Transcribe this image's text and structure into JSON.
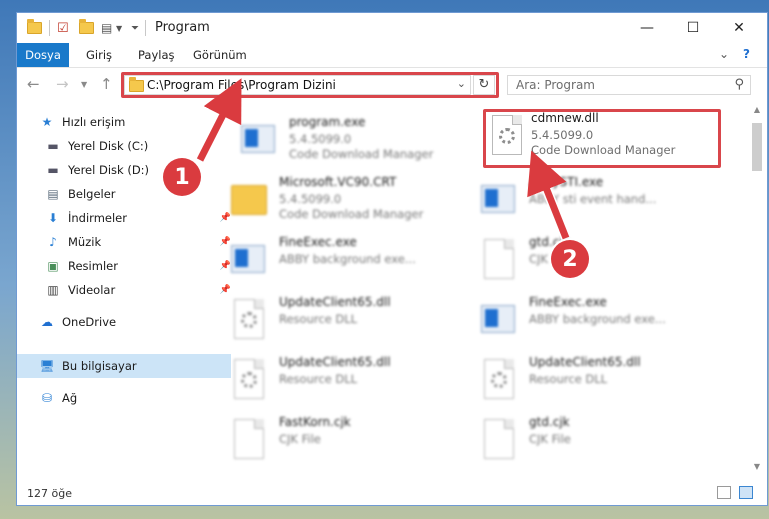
{
  "window": {
    "title": "Program"
  },
  "ribbon": {
    "tabs": [
      {
        "label": "Dosya",
        "active": true
      },
      {
        "label": "Giriş"
      },
      {
        "label": "Paylaş"
      },
      {
        "label": "Görünüm"
      }
    ]
  },
  "navbar": {
    "address": "C:\\Program Files\\Program Dizini",
    "search_placeholder": "Ara: Program"
  },
  "navpane": {
    "items": [
      {
        "label": "Hızlı erişim",
        "icon": "star-icon"
      },
      {
        "label": "Yerel Disk (C:)",
        "icon": "drive-icon"
      },
      {
        "label": "Yerel Disk (D:)",
        "icon": "drive-icon"
      },
      {
        "label": "Belgeler",
        "icon": "documents-icon"
      },
      {
        "label": "İndirmeler",
        "icon": "download-icon",
        "pinned": true
      },
      {
        "label": "Müzik",
        "icon": "music-icon",
        "pinned": true
      },
      {
        "label": "Resimler",
        "icon": "pictures-icon",
        "pinned": true
      },
      {
        "label": "Videolar",
        "icon": "videos-icon",
        "pinned": true
      },
      {
        "label": "OneDrive",
        "icon": "cloud-icon"
      },
      {
        "label": "Bu bilgisayar",
        "icon": "computer-icon",
        "selected": true
      },
      {
        "label": "Ağ",
        "icon": "network-icon"
      }
    ]
  },
  "files": [
    {
      "name": "program.exe",
      "version": "5.4.5099.0",
      "description": "Code Download Manager",
      "kind": "exe"
    },
    {
      "name": "cdmnew.dll",
      "version": "5.4.5099.0",
      "description": "Code Download Manager",
      "kind": "dll",
      "highlighted": true
    },
    {
      "name": "Microsoft.VC90.CRT",
      "version": "5.4.5099.0",
      "description": "Code Download Manager",
      "kind": "folder"
    },
    {
      "name": "AbbySTI.exe",
      "version": "ABBY sti event hand...",
      "description": "",
      "kind": "exe"
    },
    {
      "name": "FineExec.exe",
      "version": "ABBY background exe...",
      "description": "",
      "kind": "exe"
    },
    {
      "name": "gtd.cjk",
      "version": "CJK File",
      "description": "",
      "kind": "doc"
    },
    {
      "name": "UpdateClient65.dll",
      "version": "Resource DLL",
      "description": "",
      "kind": "dll"
    },
    {
      "name": "FineExec.exe",
      "version": "ABBY background exe...",
      "description": "",
      "kind": "exe"
    },
    {
      "name": "UpdateClient65.dll",
      "version": "Resource DLL",
      "description": "",
      "kind": "dll"
    },
    {
      "name": "UpdateClient65.dll",
      "version": "Resource DLL",
      "description": "",
      "kind": "dll"
    },
    {
      "name": "FastKorn.cjk",
      "version": "CJK File",
      "description": "",
      "kind": "doc"
    },
    {
      "name": "gtd.cjk",
      "version": "CJK File",
      "description": "",
      "kind": "doc"
    }
  ],
  "status": {
    "item_count": "127 öğe"
  },
  "annotations": {
    "badge1": "1",
    "badge2": "2",
    "color": "#da3b3f"
  }
}
